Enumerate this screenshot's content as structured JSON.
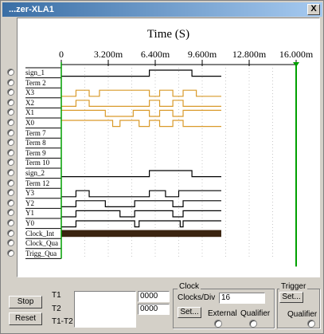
{
  "window": {
    "title": "...zer-XLA1",
    "close_glyph": "X"
  },
  "plot": {
    "title": "Time (S)",
    "tick_labels": [
      "0",
      "3.200m",
      "6.400m",
      "9.600m",
      "12.800m",
      "16.000m"
    ],
    "channels": [
      "sign_1",
      "Term 2",
      "X3",
      "X2",
      "X1",
      "X0",
      "Term 7",
      "Term 8",
      "Term 9",
      "Term 10",
      "sign_2",
      "Term 12",
      "Y3",
      "Y2",
      "Y1",
      "Y0",
      "Clock_Int",
      "Clock_Qua",
      "Trigg_Qua"
    ],
    "colors": {
      "trace": "#000000",
      "trace_x": "#d99a2a",
      "cursor_t1": "#00a000",
      "cursor_t2": "#00a000",
      "clock_band": "#3b2410",
      "grid": "#c8c8c8"
    }
  },
  "controls": {
    "stop": "Stop",
    "reset": "Reset",
    "t1": "T1",
    "t2": "T2",
    "t1t2": "T1-T2",
    "t1_value": "0000",
    "t2_value": "0000",
    "clock_group": "Clock",
    "clocks_per_div_label": "Clocks/Div",
    "clocks_per_div_value": "16",
    "clock_set": "Set...",
    "external": "External",
    "qualifier": "Qualifier",
    "trigger_group": "Trigger",
    "trigger_set": "Set...",
    "trigger_qualifier": "Qualifier"
  }
}
